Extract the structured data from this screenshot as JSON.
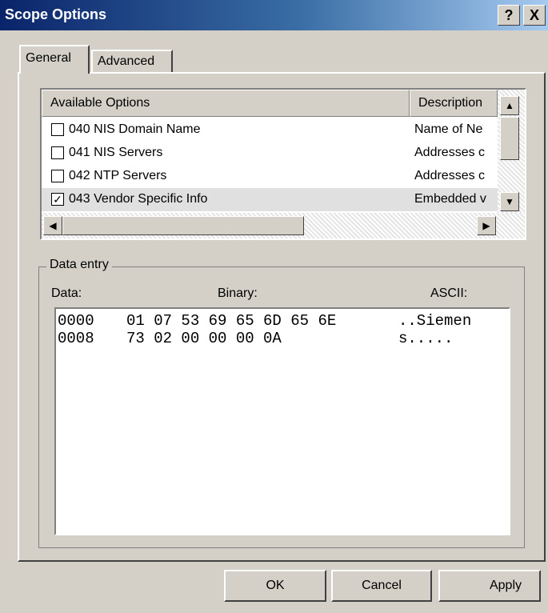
{
  "window": {
    "title": "Scope Options",
    "help_glyph": "?",
    "close_glyph": "X"
  },
  "tabs": [
    {
      "label": "General",
      "selected": true
    },
    {
      "label": "Advanced",
      "selected": false
    }
  ],
  "list": {
    "columns": [
      "Available Options",
      "Description"
    ],
    "rows": [
      {
        "option": "040 NIS Domain Name",
        "description": "Name of Ne",
        "checked": false,
        "check_glyph": ""
      },
      {
        "option": "041 NIS Servers",
        "description": "Addresses c",
        "checked": false,
        "check_glyph": ""
      },
      {
        "option": "042 NTP Servers",
        "description": "Addresses c",
        "checked": false,
        "check_glyph": ""
      },
      {
        "option": "043 Vendor Specific Info",
        "description": "Embedded v",
        "checked": true,
        "check_glyph": "✓"
      }
    ]
  },
  "data_entry": {
    "legend": "Data entry",
    "labels": {
      "data": "Data:",
      "binary": "Binary:",
      "ascii": "ASCII:"
    },
    "rows": [
      {
        "offset": "0000",
        "hex": "01 07 53 69 65 6D 65 6E",
        "ascii": "..Siemen"
      },
      {
        "offset": "0008",
        "hex": "73 02 00 00 00 0A",
        "ascii": "s....."
      }
    ]
  },
  "buttons": {
    "ok": "OK",
    "cancel": "Cancel",
    "apply": "Apply"
  },
  "icons": {
    "up": "▲",
    "down": "▼",
    "left": "◀",
    "right": "▶"
  },
  "colors": {
    "title_start": "#0a246a",
    "title_end": "#a6caf0",
    "face": "#d4d0c8",
    "selected_row": "#e0e0e0"
  }
}
